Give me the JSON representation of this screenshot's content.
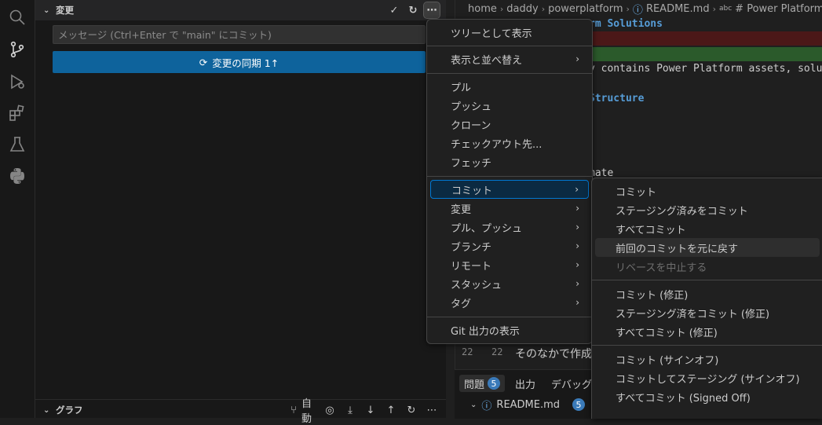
{
  "activity": [
    "search-icon",
    "source-control-icon",
    "run-debug-icon",
    "extensions-icon",
    "testing-icon",
    "python-icon"
  ],
  "scm": {
    "changes_header": "変更",
    "commit_placeholder": "メッセージ (Ctrl+Enter で \"main\" にコミット)",
    "sync_button": "変更の同期 1↑",
    "graph_header": "グラフ",
    "graph_auto": "自動"
  },
  "breadcrumb": {
    "items": [
      "home",
      "daddy",
      "powerplatform",
      "README.md"
    ],
    "symbol": "# Power Platform"
  },
  "editor": {
    "line_heading1": "rm Solutions",
    "line_text": "y contains Power Platform assets, solution",
    "line_heading2": "Structure",
    "line_partial": "mate",
    "line22_num_a": "22",
    "line22_num_b": "22",
    "line22_text": "そのなかで作成"
  },
  "bottom_panel": {
    "tab_problems": "問題",
    "tab_problems_count": "5",
    "tab_output": "出力",
    "tab_debug": "デバッグ",
    "file_name": "README.md",
    "file_count": "5"
  },
  "main_menu": {
    "items": [
      {
        "label": "ツリーとして表示"
      },
      {
        "label": "表示と並べ替え",
        "submenu": true
      },
      {
        "label": "プル"
      },
      {
        "label": "プッシュ"
      },
      {
        "label": "クローン"
      },
      {
        "label": "チェックアウト先..."
      },
      {
        "label": "フェッチ"
      },
      {
        "label": "コミット",
        "submenu": true
      },
      {
        "label": "変更",
        "submenu": true
      },
      {
        "label": "プル、プッシュ",
        "submenu": true
      },
      {
        "label": "ブランチ",
        "submenu": true
      },
      {
        "label": "リモート",
        "submenu": true
      },
      {
        "label": "スタッシュ",
        "submenu": true
      },
      {
        "label": "タグ",
        "submenu": true
      },
      {
        "label": "Git 出力の表示"
      }
    ]
  },
  "commit_menu": {
    "items": [
      {
        "label": "コミット"
      },
      {
        "label": "ステージング済みをコミット"
      },
      {
        "label": "すべてコミット"
      },
      {
        "label": "前回のコミットを元に戻す"
      },
      {
        "label": "リベースを中止する",
        "disabled": true
      },
      {
        "label": "コミット (修正)"
      },
      {
        "label": "ステージング済をコミット (修正)"
      },
      {
        "label": "すべてコミット (修正)"
      },
      {
        "label": "コミット (サインオフ)"
      },
      {
        "label": "コミットしてステージング (サインオフ)"
      },
      {
        "label": "すべてコミット (Signed Off)"
      }
    ]
  },
  "colors": {
    "accent": "#0078d4",
    "button": "#0e639c",
    "badge": "#3a7ab9"
  }
}
